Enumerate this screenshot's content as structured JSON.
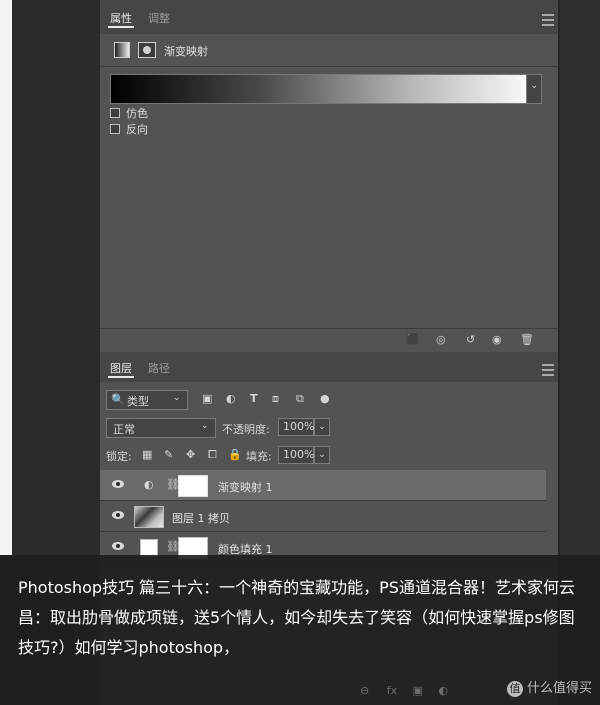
{
  "properties_panel": {
    "tabs": [
      "属性",
      "调整"
    ],
    "adjustment_title": "渐变映射",
    "dropdown_arrow": "⌄",
    "checkbox_dither": "仿色",
    "checkbox_reverse": "反向",
    "gradient": {
      "from_color": "#000000",
      "to_color": "#ffffff"
    }
  },
  "layers_panel": {
    "tabs": [
      "图层",
      "路径"
    ],
    "filter_kind": "类型",
    "blend_mode": "正常",
    "opacity_label": "不透明度:",
    "opacity_value": "100%",
    "lock_label": "锁定:",
    "fill_label": "填充:",
    "fill_value": "100%",
    "layers": [
      {
        "name": "渐变映射 1",
        "selected": true
      },
      {
        "name": "图层 1 拷贝",
        "selected": false
      },
      {
        "name": "颜色填充 1",
        "selected": false
      }
    ]
  },
  "caption": {
    "text": "Photoshop技巧 篇三十六：一个神奇的宝藏功能，PS通道混合器！艺术家何云昌：取出肋骨做成项链，送5个情人，如今却失去了笑容（如何快速掌握ps修图技巧?）如何学习photoshop，"
  },
  "watermark": {
    "icon": "值",
    "text": "什么值得买"
  },
  "icons": {
    "footer": [
      "clip-to-layer-icon",
      "view-previous-icon",
      "reset-icon",
      "visibility-icon",
      "delete-icon"
    ],
    "toolbar": [
      "image-filter-icon",
      "adjustment-filter-icon",
      "type-filter-icon",
      "shape-filter-icon",
      "smart-object-filter-icon"
    ],
    "lock": [
      "lock-transparent-icon",
      "lock-image-icon",
      "lock-position-icon",
      "lock-artboard-icon",
      "lock-all-icon"
    ]
  }
}
